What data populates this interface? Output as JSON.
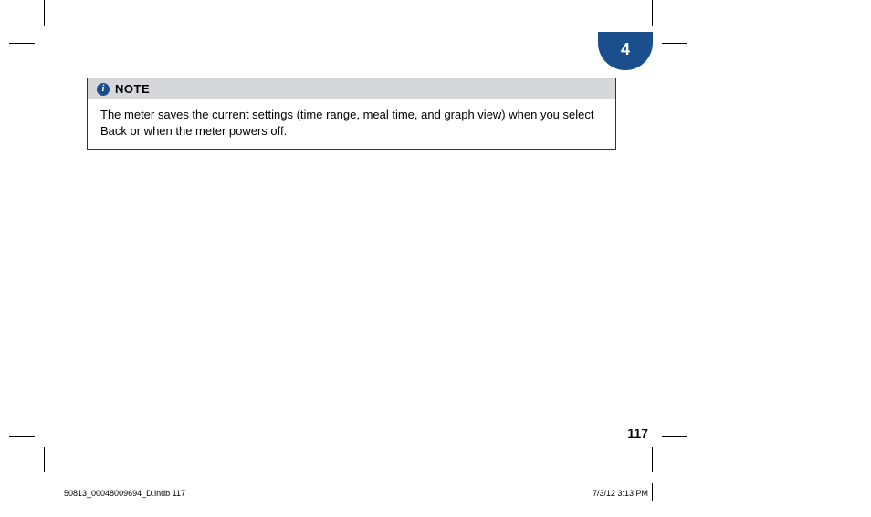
{
  "chapter": {
    "number": "4"
  },
  "note": {
    "title": "NOTE",
    "icon_glyph": "i",
    "body": "The meter saves the current settings (time range, meal time, and graph view) when you select Back or when the meter powers off."
  },
  "page_number": "117",
  "footer": {
    "left": "50813_00048009694_D.indb   117",
    "right": "7/3/12   3:13 PM"
  }
}
